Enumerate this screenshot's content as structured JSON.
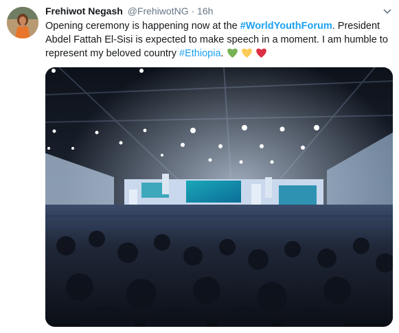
{
  "tweet": {
    "author_name": "Frehiwot Negash",
    "author_handle": "@FrehiwotNG",
    "separator": "·",
    "time": "16h",
    "text_part1": "Opening ceremony is happening now  at the ",
    "hashtag1": "#WorldYouthForum",
    "text_part2": ". President Abdel Fattah El-Sisi is expected to make speech in a moment. I am humble to represent my beloved country ",
    "hashtag2": "#Ethiopia",
    "text_part3": ". ",
    "emojis": [
      "green-heart-icon",
      "yellow-heart-icon",
      "red-heart-icon"
    ]
  },
  "colors": {
    "hashtag": "#1da1f2",
    "muted": "#657786",
    "green_heart": "#77b255",
    "yellow_heart": "#fdcb58",
    "red_heart": "#dd2e44"
  }
}
